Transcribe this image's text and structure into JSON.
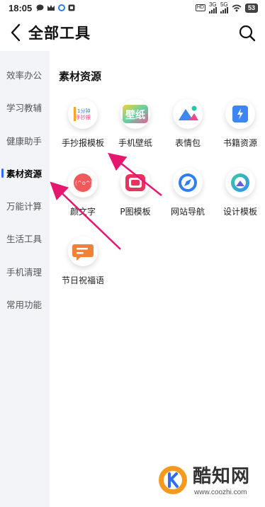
{
  "status_bar": {
    "time": "18:05",
    "signal_1": "3G",
    "signal_2": "5G",
    "hd_label": "HD",
    "battery": "53"
  },
  "header": {
    "title": "全部工具",
    "back_icon": "chevron-left-icon",
    "search_icon": "search-icon"
  },
  "sidebar": {
    "items": [
      {
        "label": "效率办公"
      },
      {
        "label": "学习教辅"
      },
      {
        "label": "健康助手"
      },
      {
        "label": "素材资源",
        "active": true
      },
      {
        "label": "万能计算"
      },
      {
        "label": "生活工具"
      },
      {
        "label": "手机清理"
      },
      {
        "label": "常用功能"
      }
    ]
  },
  "main": {
    "section_title": "素材资源",
    "tools": [
      {
        "label": "手抄报模板",
        "icon_text": "1分钟 手抄报",
        "icon": "handcopy-newspaper-icon"
      },
      {
        "label": "手机壁纸",
        "icon_text": "壁纸",
        "icon": "wallpaper-icon"
      },
      {
        "label": "表情包",
        "icon": "emoji-pack-icon"
      },
      {
        "label": "书籍资源",
        "icon": "book-resource-icon"
      },
      {
        "label": "颜文字",
        "icon_text": "(^o^)",
        "icon": "kaomoji-icon"
      },
      {
        "label": "P图模板",
        "icon": "photo-template-icon"
      },
      {
        "label": "网站导航",
        "icon": "compass-icon"
      },
      {
        "label": "设计模板",
        "icon": "design-template-icon"
      },
      {
        "label": "节日祝福语",
        "icon": "festival-greeting-icon"
      }
    ]
  },
  "watermark": {
    "name": "酷知网",
    "url": "www.coozhi.com"
  },
  "colors": {
    "accent": "#2c6df5",
    "arrow": "#e6176f",
    "sidebar_bg": "#f3f4f8"
  }
}
